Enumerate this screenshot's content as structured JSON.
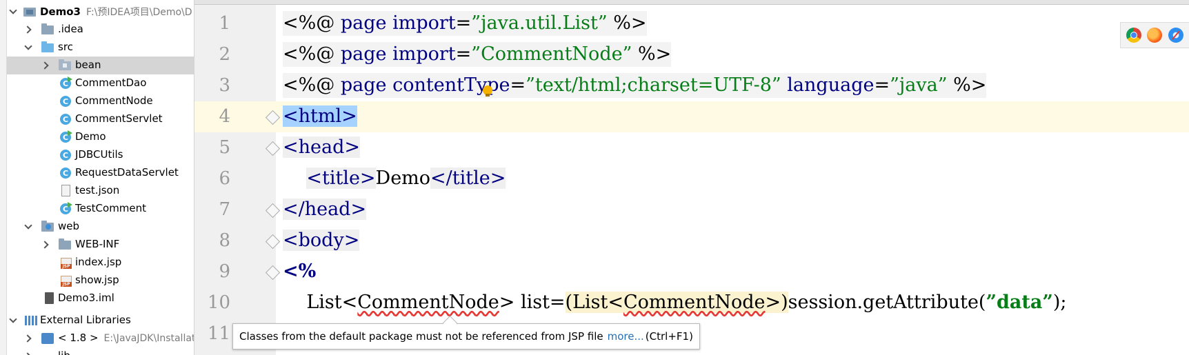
{
  "project_tree": {
    "root": {
      "name": "Demo3",
      "path": "F:\\预IDEA项目\\Demo\\D"
    },
    "items": {
      "idea": ".idea",
      "src": "src",
      "bean": "bean",
      "comment_dao": "CommentDao",
      "comment_node": "CommentNode",
      "comment_servlet": "CommentServlet",
      "demo": "Demo",
      "jdbc_utils": "JDBCUtils",
      "request_data_servlet": "RequestDataServlet",
      "test_json": "test.json",
      "test_comment": "TestComment",
      "web": "web",
      "web_inf": "WEB-INF",
      "index_jsp": "index.jsp",
      "show_jsp": "show.jsp",
      "demo3_iml": "Demo3.iml",
      "external_libraries": "External Libraries",
      "jdk_label": "< 1.8 >",
      "jdk_path": "E:\\JavaJDK\\Installat",
      "lib_partial": "lib"
    }
  },
  "editor": {
    "line_numbers": [
      "1",
      "2",
      "3",
      "4",
      "5",
      "6",
      "7",
      "8",
      "9",
      "10",
      "11"
    ],
    "tokens": {
      "d_open": "<%@",
      "d_close": "%>",
      "page": "page",
      "import": "import",
      "eq": "=",
      "import1_val": "”java.util.List”",
      "import2_val": "”CommentNode”",
      "content_type": "contentType",
      "content_type_val": "”text/html;charset=UTF-8”",
      "language": "language",
      "language_val": "”java”",
      "html_open": "<html>",
      "head_open": "<head>",
      "title_open": "<title>",
      "title_text": "Demo",
      "title_close": "</title>",
      "head_close": "</head>",
      "body_open": "<body>",
      "scriptlet_open": "<%",
      "list": "List",
      "lt": "<",
      "gt": ">",
      "comment_node": "CommentNode",
      "list_assign": " list=",
      "cast_open": "(List",
      "cast_close": ">)",
      "session_call": "session.getAttribute(",
      "data_str": "”data”",
      "call_end": ");"
    }
  },
  "tooltip": {
    "message": "Classes from the default package must not be referenced from JSP file",
    "link": "more...",
    "shortcut": "(Ctrl+F1)"
  },
  "browsers": [
    "chrome-icon",
    "firefox-icon",
    "safari-icon"
  ]
}
